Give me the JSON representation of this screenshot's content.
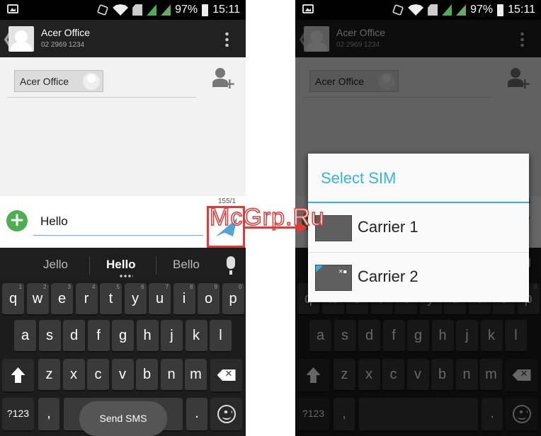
{
  "status_bar": {
    "battery": "97%",
    "time": "15:11"
  },
  "conversation": {
    "contact_name": "Acer Office",
    "contact_number": "02 2969 1234",
    "recipient_chip": "Acer Office"
  },
  "compose": {
    "char_counter": "155/1",
    "message_text": "Hello"
  },
  "keyboard": {
    "suggestions": [
      "Jello",
      "Hello",
      "Bello"
    ],
    "row1": [
      {
        "l": "q",
        "h": "1"
      },
      {
        "l": "w",
        "h": "2"
      },
      {
        "l": "e",
        "h": "3"
      },
      {
        "l": "r",
        "h": "4"
      },
      {
        "l": "t",
        "h": "5"
      },
      {
        "l": "y",
        "h": "6"
      },
      {
        "l": "u",
        "h": "7"
      },
      {
        "l": "i",
        "h": "8"
      },
      {
        "l": "o",
        "h": "9"
      },
      {
        "l": "p",
        "h": "0"
      }
    ],
    "row2": [
      "a",
      "s",
      "d",
      "f",
      "g",
      "h",
      "j",
      "k",
      "l"
    ],
    "row3": [
      "z",
      "x",
      "c",
      "v",
      "b",
      "n",
      "m"
    ],
    "symbols_key": "?123",
    "comma_key": ",",
    "period_key": ".",
    "send_sms_label": "Send SMS"
  },
  "dialog": {
    "title": "Select SIM",
    "options": [
      "Carrier 1",
      "Carrier 2"
    ]
  },
  "watermark": "McGrp.Ru",
  "colors": {
    "accent": "#33b5e5",
    "highlight": "#e53935",
    "attach": "#4caf50"
  }
}
